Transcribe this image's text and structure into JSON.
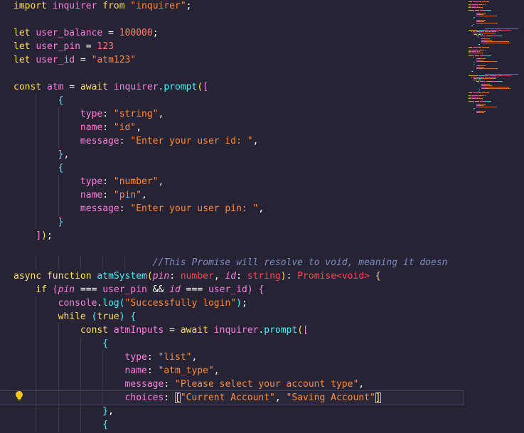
{
  "editor": {
    "lines": [
      [
        [
          "kw",
          "import"
        ],
        [
          "pun",
          " "
        ],
        [
          "var",
          "inquirer"
        ],
        [
          "pun",
          " "
        ],
        [
          "kw",
          "from"
        ],
        [
          "pun",
          " "
        ],
        [
          "str",
          "\"inquirer\""
        ],
        [
          "pun",
          ";"
        ]
      ],
      [],
      [
        [
          "kw",
          "let"
        ],
        [
          "pun",
          " "
        ],
        [
          "var",
          "user_balance"
        ],
        [
          "pun",
          " = "
        ],
        [
          "num",
          "100000"
        ],
        [
          "pun",
          ";"
        ]
      ],
      [
        [
          "kw",
          "let"
        ],
        [
          "pun",
          " "
        ],
        [
          "var",
          "user_pin"
        ],
        [
          "pun",
          " = "
        ],
        [
          "num",
          "123"
        ]
      ],
      [
        [
          "kw",
          "let"
        ],
        [
          "pun",
          " "
        ],
        [
          "var",
          "user_id"
        ],
        [
          "pun",
          " = "
        ],
        [
          "str",
          "\"atm123\""
        ]
      ],
      [],
      [
        [
          "kw",
          "const"
        ],
        [
          "pun",
          " "
        ],
        [
          "var",
          "atm"
        ],
        [
          "pun",
          " = "
        ],
        [
          "kw",
          "await"
        ],
        [
          "pun",
          " "
        ],
        [
          "var",
          "inquirer"
        ],
        [
          "pun",
          "."
        ],
        [
          "fn",
          "prompt"
        ],
        [
          "br3",
          "("
        ],
        [
          "br2",
          "["
        ]
      ],
      [
        [
          "pun",
          "        "
        ],
        [
          "br1",
          "{"
        ]
      ],
      [
        [
          "pun",
          "            "
        ],
        [
          "prop",
          "type"
        ],
        [
          "pun",
          ": "
        ],
        [
          "str",
          "\"string\""
        ],
        [
          "pun",
          ","
        ]
      ],
      [
        [
          "pun",
          "            "
        ],
        [
          "prop",
          "name"
        ],
        [
          "pun",
          ": "
        ],
        [
          "str",
          "\"id\""
        ],
        [
          "pun",
          ","
        ]
      ],
      [
        [
          "pun",
          "            "
        ],
        [
          "prop",
          "message"
        ],
        [
          "pun",
          ": "
        ],
        [
          "str",
          "\"Enter your user id: \""
        ],
        [
          "pun",
          ","
        ]
      ],
      [
        [
          "pun",
          "        "
        ],
        [
          "br1",
          "}"
        ],
        [
          "pun",
          ","
        ]
      ],
      [
        [
          "pun",
          "        "
        ],
        [
          "br1",
          "{"
        ]
      ],
      [
        [
          "pun",
          "            "
        ],
        [
          "prop",
          "type"
        ],
        [
          "pun",
          ": "
        ],
        [
          "str",
          "\"number\""
        ],
        [
          "pun",
          ","
        ]
      ],
      [
        [
          "pun",
          "            "
        ],
        [
          "prop",
          "name"
        ],
        [
          "pun",
          ": "
        ],
        [
          "str",
          "\"pin\""
        ],
        [
          "pun",
          ","
        ]
      ],
      [
        [
          "pun",
          "            "
        ],
        [
          "prop",
          "message"
        ],
        [
          "pun",
          ": "
        ],
        [
          "str",
          "\"Enter your user pin: \""
        ],
        [
          "pun",
          ","
        ]
      ],
      [
        [
          "pun",
          "        "
        ],
        [
          "br1",
          "}"
        ]
      ],
      [
        [
          "pun",
          "    "
        ],
        [
          "br2",
          "]"
        ],
        [
          "br3",
          ")"
        ],
        [
          "pun",
          ";"
        ]
      ],
      [],
      [
        [
          "pun",
          "                         "
        ],
        [
          "cm",
          "//This Promise will resolve to void, meaning it doesn"
        ]
      ],
      [
        [
          "kw",
          "async"
        ],
        [
          "pun",
          " "
        ],
        [
          "kw",
          "function"
        ],
        [
          "pun",
          " "
        ],
        [
          "fn",
          "atmSystem"
        ],
        [
          "br3",
          "("
        ],
        [
          "par",
          "pin"
        ],
        [
          "pun",
          ": "
        ],
        [
          "typ",
          "number"
        ],
        [
          "pun",
          ", "
        ],
        [
          "par",
          "id"
        ],
        [
          "pun",
          ": "
        ],
        [
          "typ",
          "string"
        ],
        [
          "br3",
          ")"
        ],
        [
          "pun",
          ": "
        ],
        [
          "typ",
          "Promise"
        ],
        [
          "typ",
          "<"
        ],
        [
          "typ",
          "void"
        ],
        [
          "typ",
          ">"
        ],
        [
          "pun",
          " "
        ],
        [
          "br3",
          "{"
        ]
      ],
      [
        [
          "pun",
          "    "
        ],
        [
          "kw",
          "if"
        ],
        [
          "pun",
          " "
        ],
        [
          "br2",
          "("
        ],
        [
          "par",
          "pin"
        ],
        [
          "pun",
          " === "
        ],
        [
          "var",
          "user_pin"
        ],
        [
          "pun",
          " && "
        ],
        [
          "par",
          "id"
        ],
        [
          "pun",
          " === "
        ],
        [
          "var",
          "user_id"
        ],
        [
          "br2",
          ")"
        ],
        [
          "pun",
          " "
        ],
        [
          "br2",
          "{"
        ]
      ],
      [
        [
          "pun",
          "        "
        ],
        [
          "var",
          "console"
        ],
        [
          "pun",
          "."
        ],
        [
          "fn",
          "log"
        ],
        [
          "br1",
          "("
        ],
        [
          "str",
          "\"Successfully login\""
        ],
        [
          "br1",
          ")"
        ],
        [
          "pun",
          ";"
        ]
      ],
      [
        [
          "pun",
          "        "
        ],
        [
          "kw",
          "while"
        ],
        [
          "pun",
          " "
        ],
        [
          "br1",
          "("
        ],
        [
          "kw",
          "true"
        ],
        [
          "br1",
          ")"
        ],
        [
          "pun",
          " "
        ],
        [
          "br1",
          "{"
        ]
      ],
      [
        [
          "pun",
          "            "
        ],
        [
          "kw",
          "const"
        ],
        [
          "pun",
          " "
        ],
        [
          "var",
          "atmInputs"
        ],
        [
          "pun",
          " = "
        ],
        [
          "kw",
          "await"
        ],
        [
          "pun",
          " "
        ],
        [
          "var",
          "inquirer"
        ],
        [
          "pun",
          "."
        ],
        [
          "fn",
          "prompt"
        ],
        [
          "br3",
          "("
        ],
        [
          "br2",
          "["
        ]
      ],
      [
        [
          "pun",
          "                "
        ],
        [
          "br1",
          "{"
        ]
      ],
      [
        [
          "pun",
          "                    "
        ],
        [
          "prop",
          "type"
        ],
        [
          "pun",
          ": "
        ],
        [
          "str",
          "\"list\""
        ],
        [
          "pun",
          ","
        ]
      ],
      [
        [
          "pun",
          "                    "
        ],
        [
          "prop",
          "name"
        ],
        [
          "pun",
          ": "
        ],
        [
          "str",
          "\"atm_type\""
        ],
        [
          "pun",
          ","
        ]
      ],
      [
        [
          "pun",
          "                    "
        ],
        [
          "prop",
          "message"
        ],
        [
          "pun",
          ": "
        ],
        [
          "str",
          "\"Please select your account type\""
        ],
        [
          "pun",
          ","
        ]
      ],
      [
        [
          "pun",
          "                    "
        ],
        [
          "prop",
          "choices"
        ],
        [
          "pun",
          ": "
        ],
        [
          "br3",
          "["
        ],
        [
          "str",
          "\"Current Account\""
        ],
        [
          "pun",
          ", "
        ],
        [
          "str",
          "\"Saving Account\""
        ],
        [
          "br3",
          "]"
        ]
      ],
      [
        [
          "pun",
          "                "
        ],
        [
          "br1",
          "}"
        ],
        [
          "pun",
          ","
        ]
      ],
      [
        [
          "pun",
          "                "
        ],
        [
          "br1",
          "{"
        ]
      ]
    ],
    "current_line": 29,
    "colors": {
      "background": "#262335",
      "keyword": "#fede5d",
      "variable": "#ff7edb",
      "function": "#36f9f6",
      "string": "#ff8b39",
      "number": "#f97e72",
      "comment": "#848bbd",
      "type": "#fe4450"
    },
    "gutter_icon": "lightbulb-icon"
  }
}
